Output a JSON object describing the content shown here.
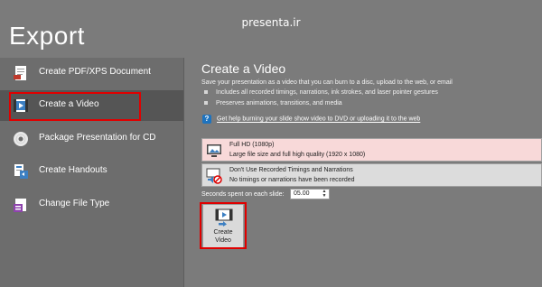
{
  "watermark": "presenta.ir",
  "backstage": {
    "title": "Export"
  },
  "nav": {
    "items": [
      {
        "label": "Create PDF/XPS Document",
        "icon": "pdf-document-icon"
      },
      {
        "label": "Create a Video",
        "icon": "video-icon",
        "selected": true
      },
      {
        "label": "Package Presentation for CD",
        "icon": "cd-icon"
      },
      {
        "label": "Create Handouts",
        "icon": "handouts-icon"
      },
      {
        "label": "Change File Type",
        "icon": "file-type-icon"
      }
    ]
  },
  "panel": {
    "title": "Create a Video",
    "description": "Save your presentation as a video that you can burn to a disc, upload to the web, or email",
    "bullets": [
      "Includes all recorded timings, narrations, ink strokes, and laser pointer gestures",
      "Preserves animations, transitions, and media"
    ],
    "help_link": "Get help burning your slide show video to DVD or uploading it to the web",
    "quality": {
      "title": "Full HD (1080p)",
      "subtitle": "Large file size and full high quality (1920 x 1080)"
    },
    "timing": {
      "title": "Don't Use Recorded Timings and Narrations",
      "subtitle": "No timings or narrations have been recorded"
    },
    "seconds": {
      "label": "Seconds spent on each slide:",
      "value": "05.00"
    },
    "create_button": {
      "line1": "Create",
      "line2": "Video"
    }
  },
  "colors": {
    "highlight": "#e00000",
    "background": "#7b7b7b",
    "nav_background": "#6d6d6d",
    "selected_background": "#555555",
    "quality_background": "#f8d9d9"
  }
}
